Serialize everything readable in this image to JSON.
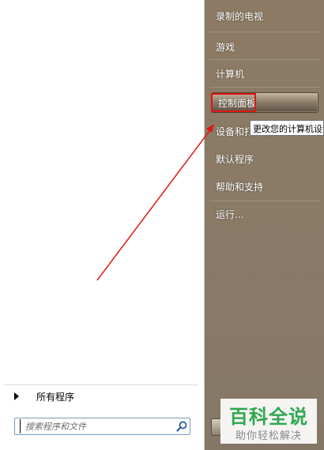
{
  "left_pane": {
    "all_programs_label": "所有程序",
    "search": {
      "placeholder": "搜索程序和文件"
    }
  },
  "right_pane": {
    "items": [
      {
        "label": "录制的电视"
      },
      {
        "label": "游戏"
      },
      {
        "label": "计算机"
      },
      {
        "label": "控制面板"
      },
      {
        "label": "设备和打印机"
      },
      {
        "label": "默认程序"
      },
      {
        "label": "帮助和支持"
      },
      {
        "label": "运行..."
      }
    ]
  },
  "tooltip": {
    "text": "更改您的计算机设置"
  },
  "watermark": {
    "title": "百科全说",
    "subtitle": "助你轻松解决"
  },
  "colors": {
    "annotation_red": "#e01515",
    "right_pane_bg": "#8a7a66",
    "watermark_green": "#2fa84f"
  }
}
